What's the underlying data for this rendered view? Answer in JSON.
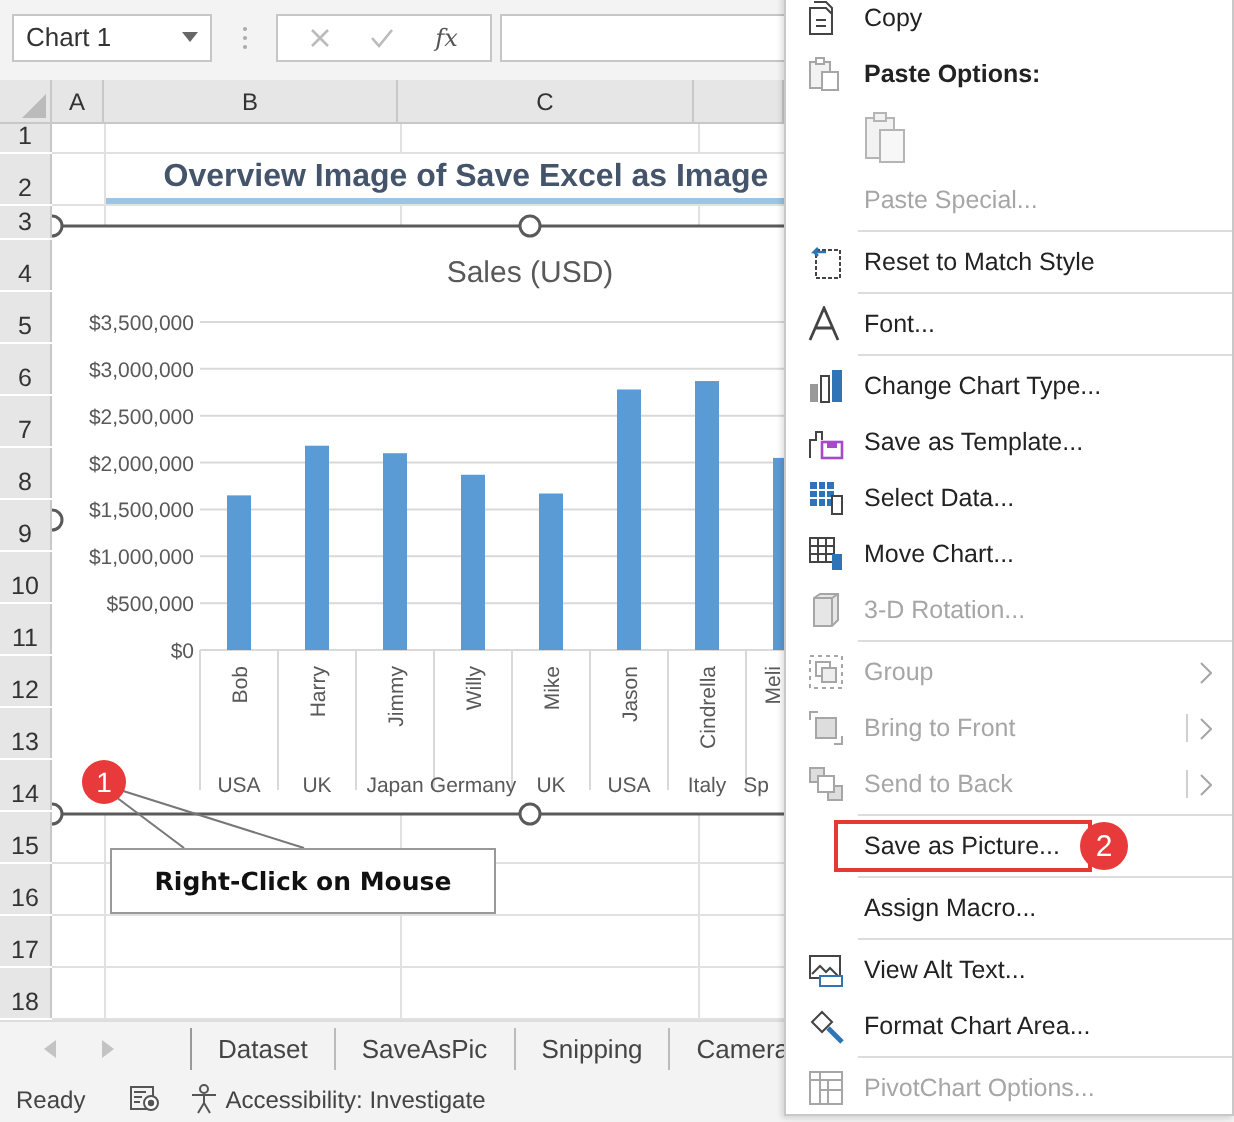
{
  "formula_bar": {
    "name_box": "Chart 1",
    "function_label": "fx"
  },
  "sheet": {
    "columns": [
      "A",
      "B",
      "C"
    ],
    "rows": [
      {
        "number": "1"
      },
      {
        "number": "2",
        "title": "Overview Image of Save Excel as Image"
      },
      {
        "number": "3"
      },
      {
        "number": "4"
      },
      {
        "number": "5"
      },
      {
        "number": "6"
      },
      {
        "number": "7"
      },
      {
        "number": "8"
      },
      {
        "number": "9"
      },
      {
        "number": "10"
      },
      {
        "number": "11"
      },
      {
        "number": "12"
      },
      {
        "number": "13"
      },
      {
        "number": "14"
      },
      {
        "number": "15"
      },
      {
        "number": "16"
      },
      {
        "number": "17"
      },
      {
        "number": "18"
      }
    ]
  },
  "chart": {
    "chart_data": {
      "type": "bar",
      "title": "Sales (USD)",
      "categories": [
        "Bob",
        "Harry",
        "Jimmy",
        "Willy",
        "Mike",
        "Jason",
        "Cindrella",
        "Meli"
      ],
      "grid": true,
      "series": [
        {
          "color": "#5b9bd5",
          "values": [
            1650000,
            2180000,
            2100000,
            1870000,
            1670000,
            2780000,
            2870000,
            2050000
          ]
        }
      ],
      "ylim": [
        0,
        3500000
      ],
      "yticks": [
        {
          "value": 0,
          "label": "$0"
        },
        {
          "value": 500000,
          "label": "$500,000"
        },
        {
          "value": 1000000,
          "label": "$1,000,000"
        },
        {
          "value": 1500000,
          "label": "$1,500,000"
        },
        {
          "value": 2000000,
          "label": "$2,000,000"
        },
        {
          "value": 2500000,
          "label": "$2,500,000"
        },
        {
          "value": 3000000,
          "label": "$3,000,000"
        },
        {
          "value": 3500000,
          "label": "$3,500,000"
        }
      ]
    },
    "category_groups": [
      "USA",
      "UK",
      "Japan",
      "Germany",
      "UK",
      "USA",
      "Italy",
      "Sp"
    ]
  },
  "callouts": [
    {
      "number": "1",
      "text": "Right-Click on Mouse"
    },
    {
      "number": "2"
    }
  ],
  "context_menu": [
    {
      "kind": "item",
      "label": "Copy",
      "disabled": false
    },
    {
      "kind": "header",
      "label": "Paste Options:"
    },
    {
      "kind": "paste-option",
      "disabled": true
    },
    {
      "kind": "item",
      "label": "Paste Special...",
      "disabled": true
    },
    {
      "kind": "separator"
    },
    {
      "kind": "item",
      "label": "Reset to Match Style",
      "disabled": false
    },
    {
      "kind": "separator"
    },
    {
      "kind": "item",
      "label": "Font...",
      "disabled": false
    },
    {
      "kind": "separator"
    },
    {
      "kind": "item",
      "label": "Change Chart Type...",
      "disabled": false
    },
    {
      "kind": "item",
      "label": "Save as Template...",
      "disabled": false
    },
    {
      "kind": "item",
      "label": "Select Data...",
      "disabled": false
    },
    {
      "kind": "item",
      "label": "Move Chart...",
      "disabled": false
    },
    {
      "kind": "item",
      "label": "3-D Rotation...",
      "disabled": true
    },
    {
      "kind": "separator"
    },
    {
      "kind": "item",
      "label": "Group",
      "disabled": true,
      "submenu": true,
      "split": false
    },
    {
      "kind": "item",
      "label": "Bring to Front",
      "disabled": true,
      "submenu": true,
      "split": true
    },
    {
      "kind": "item",
      "label": "Send to Back",
      "disabled": true,
      "submenu": true,
      "split": true
    },
    {
      "kind": "separator"
    },
    {
      "kind": "item",
      "label": "Save as Picture...",
      "disabled": false,
      "highlighted": true
    },
    {
      "kind": "separator"
    },
    {
      "kind": "item",
      "label": "Assign Macro...",
      "disabled": false
    },
    {
      "kind": "separator"
    },
    {
      "kind": "item",
      "label": "View Alt Text...",
      "disabled": false
    },
    {
      "kind": "item",
      "label": "Format Chart Area...",
      "disabled": false
    },
    {
      "kind": "separator"
    },
    {
      "kind": "item",
      "label": "PivotChart Options...",
      "disabled": true
    }
  ],
  "sheet_tabs": [
    {
      "label": "Dataset"
    },
    {
      "label": "SaveAsPic"
    },
    {
      "label": "Snipping"
    },
    {
      "label": "Camera"
    }
  ],
  "status_bar": {
    "mode": "Ready",
    "accessibility": "Accessibility: Investigate"
  }
}
